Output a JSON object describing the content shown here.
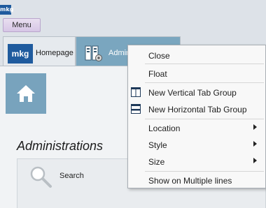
{
  "app": {
    "logo_text": "mkg",
    "menu_label": "Menu"
  },
  "tabs": [
    {
      "label": "Homepage",
      "logo_text": "mkg",
      "active": false
    },
    {
      "label": "Admin",
      "active": true
    }
  ],
  "content": {
    "title": "Administrations",
    "search_label": "Search"
  },
  "context_menu": {
    "items": [
      {
        "label": "Close",
        "icon": "",
        "submenu": false
      },
      {
        "label": "Float",
        "icon": "",
        "submenu": false
      },
      {
        "label": "New Vertical Tab Group",
        "icon": "vertical-tab-group-icon",
        "submenu": false
      },
      {
        "label": "New Horizontal Tab Group",
        "icon": "horizontal-tab-group-icon",
        "submenu": false
      },
      {
        "label": "Location",
        "icon": "",
        "submenu": true
      },
      {
        "label": "Style",
        "icon": "",
        "submenu": true
      },
      {
        "label": "Size",
        "icon": "",
        "submenu": true
      },
      {
        "label": "Show on Multiple lines",
        "icon": "",
        "submenu": false
      }
    ]
  },
  "colors": {
    "brand_blue": "#1f5b9e",
    "tile_blue": "#78a3bd",
    "active_tab": "#7aa6bf",
    "menu_button": "#d7c6e6"
  }
}
